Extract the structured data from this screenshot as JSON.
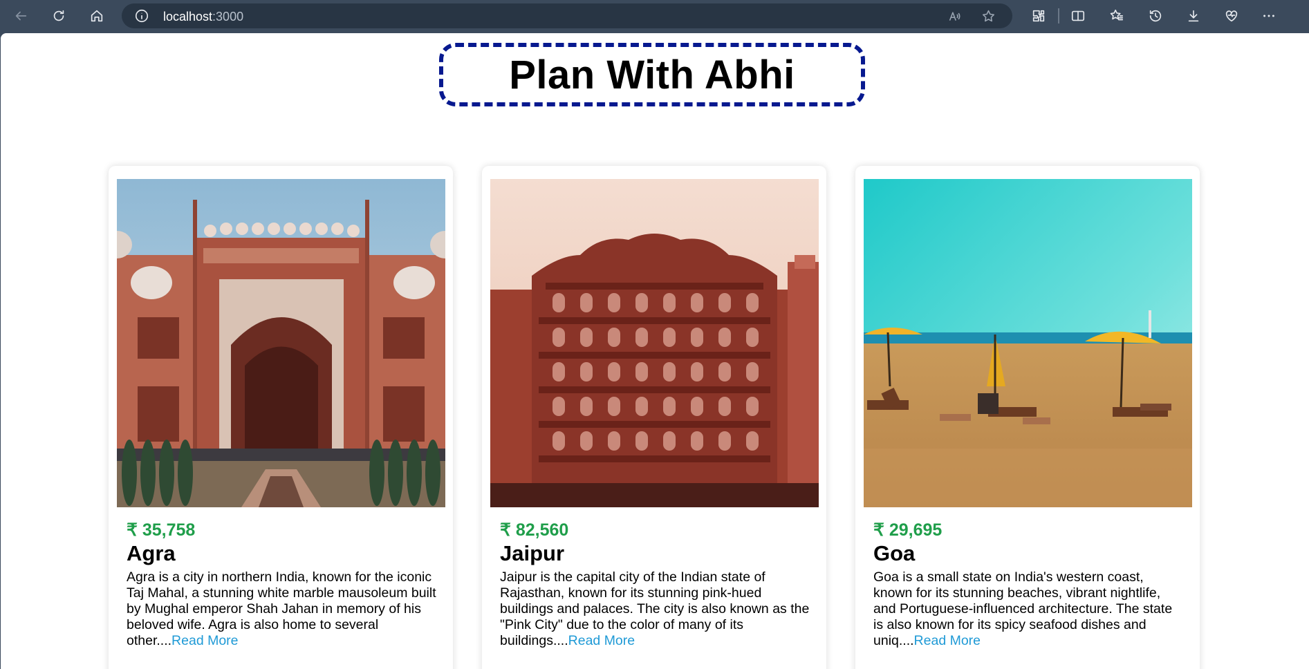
{
  "browser": {
    "url_host": "localhost",
    "url_port": ":3000"
  },
  "page": {
    "title": "Plan With Abhi"
  },
  "cards": [
    {
      "price": "₹ 35,758",
      "name": "Agra",
      "description": "Agra is a city in northern India, known for the iconic Taj Mahal, a stunning white marble mausoleum built by Mughal emperor Shah Jahan in memory of his beloved wife. Agra is also home to several other....",
      "read_more": "Read More",
      "image": "agra-gateway-photo"
    },
    {
      "price": "₹ 82,560",
      "name": "Jaipur",
      "description": "Jaipur is the capital city of the Indian state of Rajasthan, known for its stunning pink-hued buildings and palaces. The city is also known as the \"Pink City\" due to the color of many of its buildings....",
      "read_more": "Read More",
      "image": "jaipur-hawa-mahal-photo"
    },
    {
      "price": "₹ 29,695",
      "name": "Goa",
      "description": "Goa is a small state on India's western coast, known for its stunning beaches, vibrant nightlife, and Portuguese-influenced architecture. The state is also known for its spicy seafood dishes and uniq....",
      "read_more": "Read More",
      "image": "goa-beach-photo"
    }
  ],
  "colors": {
    "price": "#1f9e4a",
    "link": "#1f9ad6",
    "title_border": "#07198f",
    "chrome": "#3b4a5c"
  },
  "icons": [
    "back-icon",
    "reload-icon",
    "home-icon",
    "site-info-icon",
    "read-aloud-icon",
    "favorite-star-icon",
    "extensions-icon",
    "split-screen-icon",
    "favorites-icon",
    "history-icon",
    "downloads-icon",
    "browser-essentials-icon",
    "more-icon"
  ]
}
